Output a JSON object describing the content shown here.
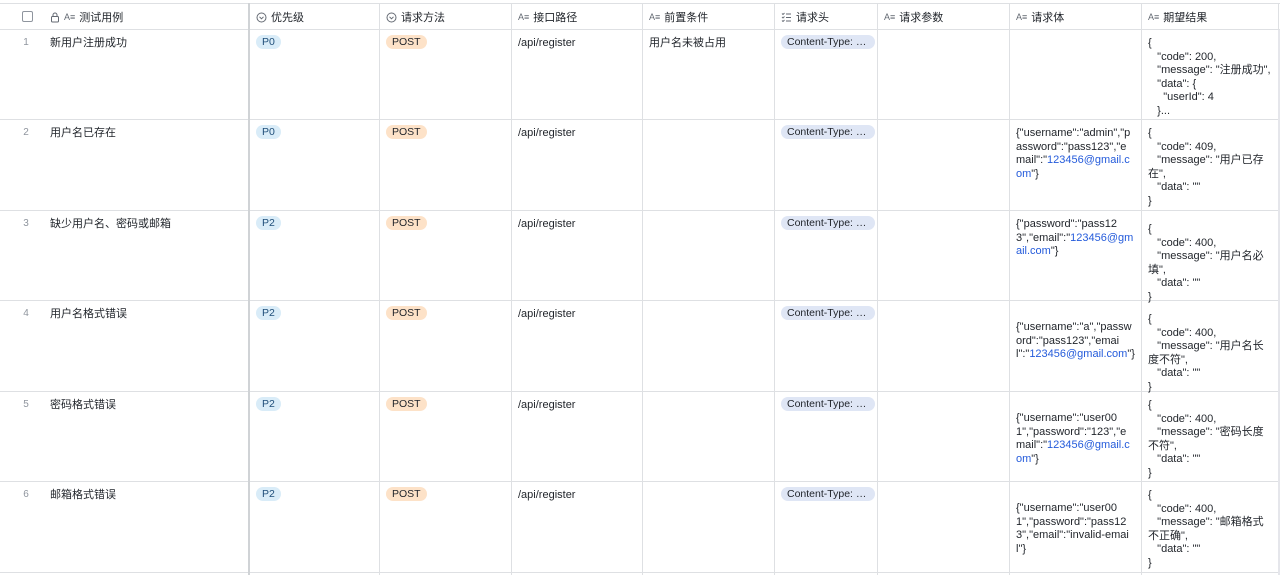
{
  "columns": {
    "case": "测试用例",
    "priority": "优先级",
    "method": "请求方法",
    "path": "接口路径",
    "precondition": "前置条件",
    "headers": "请求头",
    "params": "请求参数",
    "body": "请求体",
    "expected": "期望结果"
  },
  "icons": {
    "checkbox": "checkbox-icon",
    "lock": "lock-icon",
    "text": "text-field-icon",
    "select": "single-select-icon",
    "multiselect": "multi-select-icon"
  },
  "rows": [
    {
      "num": "1",
      "case": "新用户注册成功",
      "priority": "P0",
      "method": "POST",
      "path": "/api/register",
      "precondition": "用户名未被占用",
      "headers": "Content-Type: a...",
      "params": "",
      "body_pre": "",
      "body_email": "",
      "body_post": "",
      "expected": "{\n   \"code\": 200,\n   \"message\": \"注册成功\",\n   \"data\": {\n     \"userId\": 4\n   }..."
    },
    {
      "num": "2",
      "case": "用户名已存在",
      "priority": "P0",
      "method": "POST",
      "path": "/api/register",
      "precondition": "",
      "headers": "Content-Type: a...",
      "params": "",
      "body_pre": "{\"username\":\"admin\",\"password\":\"pass123\",\"email\":\"",
      "body_email": "123456@gmail.com",
      "body_post": "\"}",
      "expected": "{\n   \"code\": 409,\n   \"message\": \"用户已存\n在\",\n   \"data\": \"\"\n}"
    },
    {
      "num": "3",
      "case": "缺少用户名、密码或邮箱",
      "priority": "P2",
      "method": "POST",
      "path": "/api/register",
      "precondition": "",
      "headers": "Content-Type: a...",
      "params": "",
      "body_pre": "{\"password\":\"pass123\",\"email\":\"",
      "body_email": "123456@gmail.com",
      "body_post": "\"}",
      "expected": "{\n   \"code\": 400,\n   \"message\": \"用户名必\n填\",\n   \"data\": \"\"\n}"
    },
    {
      "num": "4",
      "case": "用户名格式错误",
      "priority": "P2",
      "method": "POST",
      "path": "/api/register",
      "precondition": "",
      "headers": "Content-Type: a...",
      "params": "",
      "body_pre": "{\"username\":\"a\",\"password\":\"pass123\",\"email\":\"",
      "body_email": "123456@gmail.com",
      "body_post": "\"}",
      "expected": "{\n   \"code\": 400,\n   \"message\": \"用户名长\n度不符\",\n   \"data\": \"\"\n}"
    },
    {
      "num": "5",
      "case": "密码格式错误",
      "priority": "P2",
      "method": "POST",
      "path": "/api/register",
      "precondition": "",
      "headers": "Content-Type: a...",
      "params": "",
      "body_pre": "{\"username\":\"user001\",\"password\":\"123\",\"email\":\"",
      "body_email": "123456@gmail.com",
      "body_post": "\"}",
      "expected": "{\n   \"code\": 400,\n   \"message\": \"密码长度\n不符\",\n   \"data\": \"\"\n}"
    },
    {
      "num": "6",
      "case": "邮箱格式错误",
      "priority": "P2",
      "method": "POST",
      "path": "/api/register",
      "precondition": "",
      "headers": "Content-Type: a...",
      "params": "",
      "body_pre": "{\"username\":\"user001\",\"password\":\"pass123\",\"email\":\"invalid-email\"}",
      "body_email": "",
      "body_post": "",
      "expected": "{\n   \"code\": 400,\n   \"message\": \"邮箱格式\n不正确\",\n   \"data\": \"\"\n}"
    }
  ]
}
